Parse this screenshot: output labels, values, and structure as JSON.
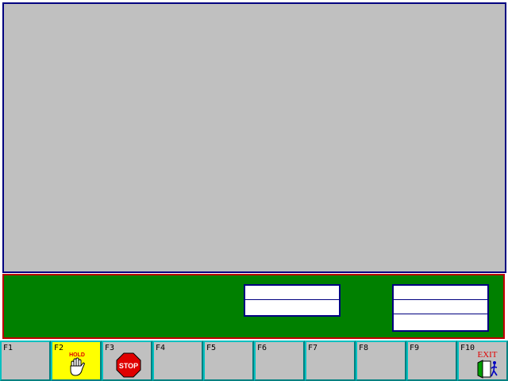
{
  "function_keys": [
    {
      "key": "F1"
    },
    {
      "key": "F2",
      "icon": "hold-hand-icon",
      "icon_text": "HOLD",
      "active": true,
      "highlight_color": "#ffff00"
    },
    {
      "key": "F3",
      "icon": "stop-sign-icon",
      "icon_text": "STOP"
    },
    {
      "key": "F4"
    },
    {
      "key": "F5"
    },
    {
      "key": "F6"
    },
    {
      "key": "F7"
    },
    {
      "key": "F8"
    },
    {
      "key": "F9"
    },
    {
      "key": "F10",
      "icon": "exit-door-icon",
      "icon_text": "EXIT"
    }
  ],
  "colors": {
    "main_panel": "#c0c0c0",
    "main_border": "#000080",
    "status_panel": "#008000",
    "status_border": "#c00000",
    "stop_sign": "#e00000",
    "exit_text": "#e00000"
  }
}
